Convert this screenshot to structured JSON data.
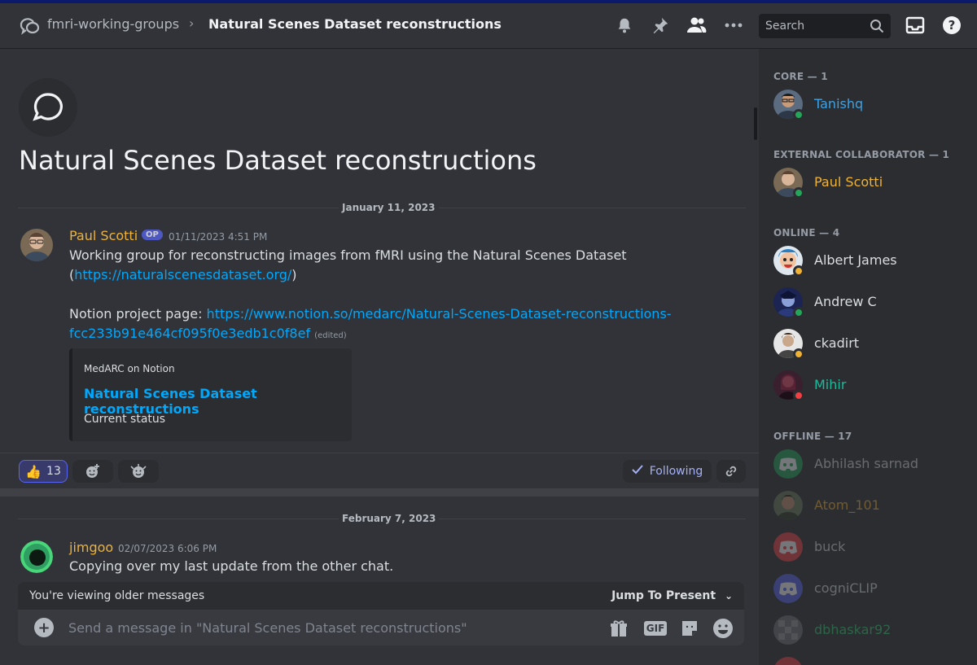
{
  "header": {
    "parent_channel": "fmri-working-groups",
    "separator": "›",
    "thread_title": "Natural Scenes Dataset reconstructions",
    "search_placeholder": "Search",
    "icons": [
      "bell-icon",
      "pin-icon",
      "members-icon",
      "more-icon",
      "search-icon",
      "inbox-icon",
      "help-icon"
    ]
  },
  "thread": {
    "title": "Natural Scenes Dataset reconstructions"
  },
  "messages": [
    {
      "date_divider": "January 11, 2023",
      "author": "Paul Scotti",
      "author_color": "#f0b232",
      "badge": "OP",
      "timestamp": "01/11/2023 4:51 PM",
      "line1": "Working group for reconstructing images from fMRI using the Natural Scenes Dataset",
      "line2_prefix": "(",
      "line2_link": "https://naturalscenesdataset.org/",
      "line2_suffix": ")",
      "notion_label": "Notion project page: ",
      "notion_link_1": "https://www.notion.so/medarc/Natural-Scenes-Dataset-reconstructions-",
      "notion_link_2": "fcc233b91e464cf095f0e3edb1c0f8ef",
      "edited": "(edited)",
      "embed": {
        "provider": "MedARC on Notion",
        "title": "Natural Scenes Dataset reconstructions",
        "description": "Current status"
      },
      "reactions": [
        {
          "emoji": "👍",
          "count": "13"
        }
      ],
      "following_label": "Following"
    },
    {
      "date_divider": "February 7, 2023",
      "author": "jimgoo",
      "author_color": "#f0b232",
      "timestamp": "02/07/2023 6:06 PM",
      "text": "Copying over my last update from the other chat."
    }
  ],
  "composer": {
    "older_notice": "You're viewing older messages",
    "jump_label": "Jump To Present",
    "placeholder": "Send a message in \"Natural Scenes Dataset reconstructions\"",
    "gif_label": "GIF"
  },
  "members": {
    "groups": [
      {
        "header": "CORE — 1",
        "members": [
          {
            "name": "Tanishq",
            "color": "#3ba3e8",
            "status": "online"
          }
        ]
      },
      {
        "header": "EXTERNAL COLLABORATOR — 1",
        "members": [
          {
            "name": "Paul Scotti",
            "color": "#f0b232",
            "status": "online"
          }
        ]
      },
      {
        "header": "ONLINE — 4",
        "members": [
          {
            "name": "Albert James",
            "color": "#dbdee1",
            "status": "idle"
          },
          {
            "name": "Andrew C",
            "color": "#dbdee1",
            "status": "online"
          },
          {
            "name": "ckadirt",
            "color": "#dbdee1",
            "status": "idle"
          },
          {
            "name": "Mihir",
            "color": "#1abc9c",
            "status": "dnd"
          }
        ]
      },
      {
        "header": "OFFLINE — 17",
        "members": [
          {
            "name": "Abhilash sarnad",
            "color": "#dbdee1"
          },
          {
            "name": "Atom_101",
            "color": "#f0b232"
          },
          {
            "name": "buck",
            "color": "#dbdee1"
          },
          {
            "name": "cogniCLIP",
            "color": "#dbdee1"
          },
          {
            "name": "dbhaskar92",
            "color": "#2ecc71"
          }
        ]
      }
    ]
  }
}
